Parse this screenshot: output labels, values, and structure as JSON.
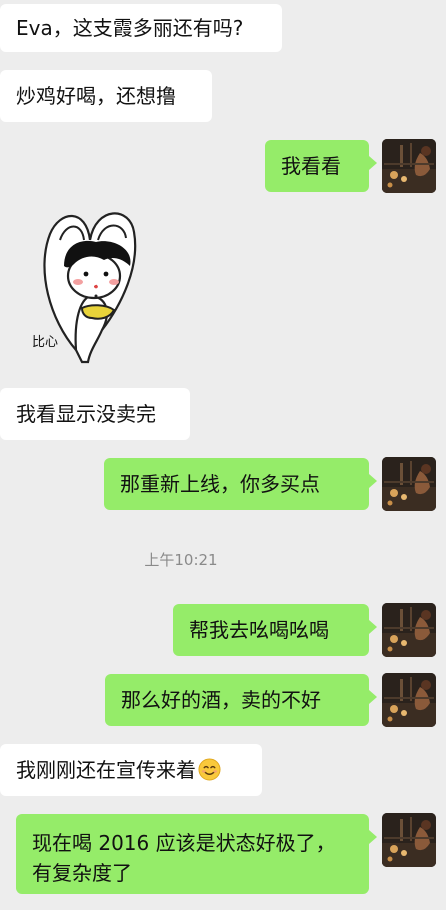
{
  "messages": [
    {
      "id": "m1",
      "side": "in",
      "text": "Eva，这支霞多丽还有吗?"
    },
    {
      "id": "m2",
      "side": "in",
      "text": "炒鸡好喝，还想撸"
    },
    {
      "id": "m3",
      "side": "out",
      "text": "我看看"
    },
    {
      "id": "m4",
      "side": "in",
      "type": "sticker",
      "caption": "比心"
    },
    {
      "id": "m5",
      "side": "in",
      "text": "我看显示没卖完"
    },
    {
      "id": "m6",
      "side": "out",
      "text": "那重新上线，你多买点"
    },
    {
      "id": "m7",
      "side": "out",
      "text": "帮我去吆喝吆喝"
    },
    {
      "id": "m8",
      "side": "out",
      "text": "那么好的酒，卖的不好"
    },
    {
      "id": "m9",
      "side": "in",
      "text": "我刚刚还在宣传来着",
      "emoji": "smiling-face-icon"
    },
    {
      "id": "m10",
      "side": "out",
      "text_line1": "现在喝 2016 应该是状态好极了，",
      "text_line2": "有复杂度了"
    }
  ],
  "timestamp": "上午10:21",
  "colors": {
    "background": "#ededed",
    "incoming_bubble": "#ffffff",
    "outgoing_bubble": "#95ec69",
    "timestamp_text": "#8a8a8a"
  }
}
